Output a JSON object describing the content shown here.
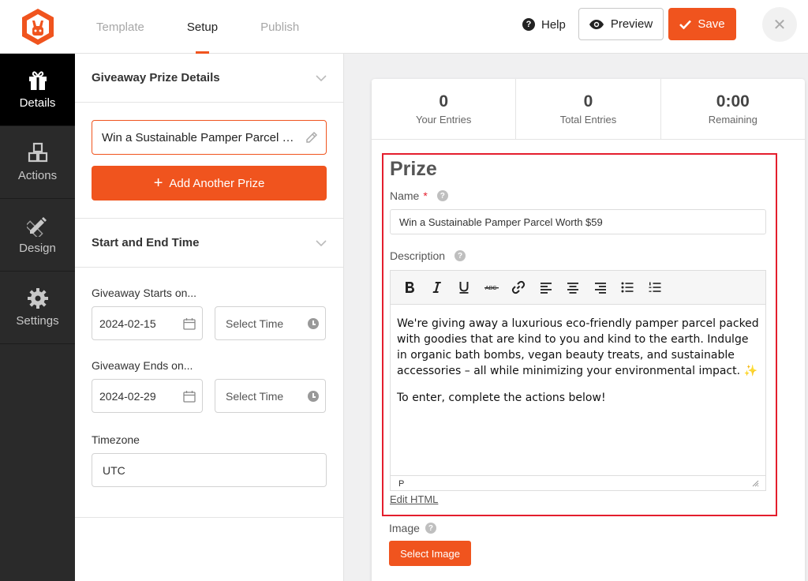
{
  "tabs": [
    {
      "label": "Template",
      "active": false
    },
    {
      "label": "Setup",
      "active": true
    },
    {
      "label": "Publish",
      "active": false
    }
  ],
  "header": {
    "help_label": "Help",
    "help_glyph": "?",
    "preview_label": "Preview",
    "save_label": "Save",
    "close_glyph": "✕",
    "accent_color": "#f0541e"
  },
  "sidebar": {
    "items": [
      {
        "label": "Details",
        "icon": "gift-icon",
        "active": true
      },
      {
        "label": "Actions",
        "icon": "cubes-icon",
        "active": false
      },
      {
        "label": "Design",
        "icon": "pencil-ruler-icon",
        "active": false
      },
      {
        "label": "Settings",
        "icon": "gear-icon",
        "active": false
      }
    ]
  },
  "prize_details": {
    "title": "Giveaway Prize Details",
    "prize_name": "Win a Sustainable Pamper Parcel Worth $59",
    "add_button": "Add Another Prize",
    "add_glyph": "+"
  },
  "schedule": {
    "title": "Start and End Time",
    "starts_label": "Giveaway Starts on...",
    "start_date": "2024-02-15",
    "start_time_placeholder": "Select Time",
    "ends_label": "Giveaway Ends on...",
    "end_date": "2024-02-29",
    "end_time_placeholder": "Select Time",
    "timezone_label": "Timezone",
    "timezone_value": "UTC"
  },
  "stats": [
    {
      "value": "0",
      "label": "Your Entries"
    },
    {
      "value": "0",
      "label": "Total Entries"
    },
    {
      "value": "0:00",
      "label": "Remaining"
    }
  ],
  "prize_form": {
    "title": "Prize",
    "name_label": "Name",
    "required_mark": "*",
    "help_glyph": "?",
    "name_value": "Win a Sustainable Pamper Parcel Worth $59",
    "description_label": "Description",
    "description_p1": "We're giving away a luxurious eco-friendly pamper parcel packed with goodies that are kind to you and kind to the earth. Indulge in organic bath bombs, vegan beauty treats, and sustainable accessories – all while minimizing your environmental impact. ✨",
    "description_p2": "To enter, complete the actions below!",
    "status_path": "P",
    "edit_html": "Edit HTML",
    "image_label": "Image",
    "select_image": "Select Image",
    "highlight_color": "#e41e2d"
  },
  "toolbar_buttons": [
    "bold",
    "italic",
    "underline",
    "strikethrough",
    "link",
    "align-left",
    "align-center",
    "align-right",
    "bullet-list",
    "numbered-list"
  ]
}
